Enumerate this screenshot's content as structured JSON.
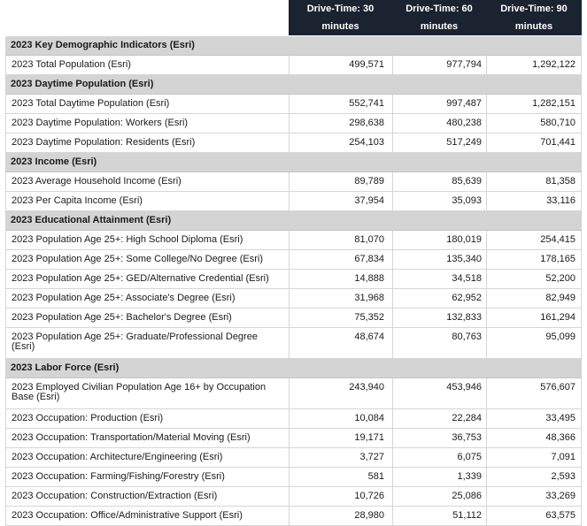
{
  "columns": [
    {
      "label": "Drive-Time: 30 minutes"
    },
    {
      "label": "Drive-Time: 60 minutes"
    },
    {
      "label": "Drive-Time: 90 minutes"
    }
  ],
  "sections": [
    {
      "title": "2023 Key Demographic Indicators (Esri)",
      "rows": [
        {
          "label": "2023 Total Population (Esri)",
          "v30": "499,571",
          "v60": "977,794",
          "v90": "1,292,122"
        }
      ]
    },
    {
      "title": "2023 Daytime Population (Esri)",
      "rows": [
        {
          "label": "2023 Total Daytime Population (Esri)",
          "v30": "552,741",
          "v60": "997,487",
          "v90": "1,282,151"
        },
        {
          "label": "2023 Daytime Population: Workers (Esri)",
          "v30": "298,638",
          "v60": "480,238",
          "v90": "580,710"
        },
        {
          "label": "2023 Daytime Population: Residents (Esri)",
          "v30": "254,103",
          "v60": "517,249",
          "v90": "701,441"
        }
      ]
    },
    {
      "title": "2023 Income (Esri)",
      "rows": [
        {
          "label": "2023 Average Household Income (Esri)",
          "v30": "89,789",
          "v60": "85,639",
          "v90": "81,358"
        },
        {
          "label": "2023 Per Capita Income (Esri)",
          "v30": "37,954",
          "v60": "35,093",
          "v90": "33,116"
        }
      ]
    },
    {
      "title": "2023 Educational Attainment (Esri)",
      "rows": [
        {
          "label": "2023 Population Age 25+: High School Diploma (Esri)",
          "v30": "81,070",
          "v60": "180,019",
          "v90": "254,415"
        },
        {
          "label": "2023 Population Age 25+: Some College/No Degree (Esri)",
          "v30": "67,834",
          "v60": "135,340",
          "v90": "178,165"
        },
        {
          "label": "2023 Population Age 25+: GED/Alternative Credential (Esri)",
          "v30": "14,888",
          "v60": "34,518",
          "v90": "52,200"
        },
        {
          "label": "2023 Population Age 25+: Associate's Degree (Esri)",
          "v30": "31,968",
          "v60": "62,952",
          "v90": "82,949"
        },
        {
          "label": "2023 Population Age 25+: Bachelor's Degree (Esri)",
          "v30": "75,352",
          "v60": "132,833",
          "v90": "161,294"
        },
        {
          "label": "2023 Population Age 25+: Graduate/Professional Degree (Esri)",
          "v30": "48,674",
          "v60": "80,763",
          "v90": "95,099",
          "tall": true
        }
      ]
    },
    {
      "title": "2023 Labor Force (Esri)",
      "rows": [
        {
          "label": "2023 Employed Civilian Population Age 16+ by Occupation Base (Esri)",
          "v30": "243,940",
          "v60": "453,946",
          "v90": "576,607",
          "tall": true
        },
        {
          "label": "2023 Occupation: Production (Esri)",
          "v30": "10,084",
          "v60": "22,284",
          "v90": "33,495"
        },
        {
          "label": "2023 Occupation: Transportation/Material Moving (Esri)",
          "v30": "19,171",
          "v60": "36,753",
          "v90": "48,366"
        },
        {
          "label": "2023 Occupation: Architecture/Engineering (Esri)",
          "v30": "3,727",
          "v60": "6,075",
          "v90": "7,091"
        },
        {
          "label": "2023 Occupation: Farming/Fishing/Forestry (Esri)",
          "v30": "581",
          "v60": "1,339",
          "v90": "2,593"
        },
        {
          "label": "2023 Occupation: Construction/Extraction (Esri)",
          "v30": "10,726",
          "v60": "25,086",
          "v90": "33,269"
        },
        {
          "label": "2023 Occupation: Office/Administrative Support (Esri)",
          "v30": "28,980",
          "v60": "51,112",
          "v90": "63,575"
        }
      ]
    }
  ]
}
